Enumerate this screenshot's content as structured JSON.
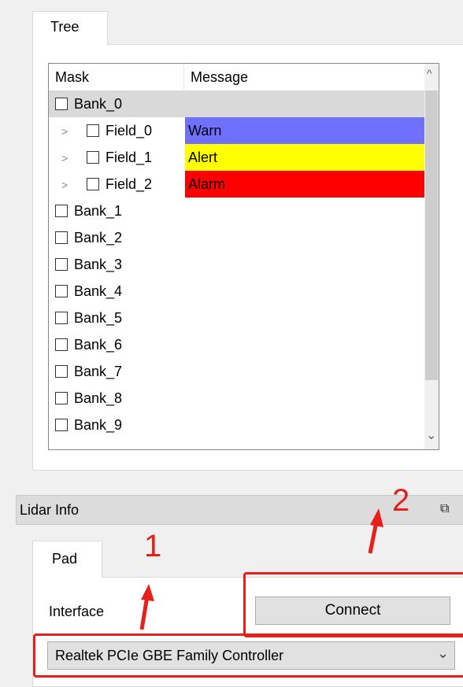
{
  "tree_tab": {
    "label": "Tree"
  },
  "table": {
    "headers": [
      "Mask",
      "Message"
    ],
    "rows": [
      {
        "label": "Bank_0",
        "level": 0,
        "selected": true,
        "message": "",
        "color": ""
      },
      {
        "label": "Field_0",
        "level": 1,
        "message": "Warn",
        "color": "#7070ff"
      },
      {
        "label": "Field_1",
        "level": 1,
        "message": "Alert",
        "color": "#ffff00"
      },
      {
        "label": "Field_2",
        "level": 1,
        "message": "Alarm",
        "color": "#ff0000"
      },
      {
        "label": "Bank_1",
        "level": 0,
        "message": "",
        "color": ""
      },
      {
        "label": "Bank_2",
        "level": 0,
        "message": "",
        "color": ""
      },
      {
        "label": "Bank_3",
        "level": 0,
        "message": "",
        "color": ""
      },
      {
        "label": "Bank_4",
        "level": 0,
        "message": "",
        "color": ""
      },
      {
        "label": "Bank_5",
        "level": 0,
        "message": "",
        "color": ""
      },
      {
        "label": "Bank_6",
        "level": 0,
        "message": "",
        "color": ""
      },
      {
        "label": "Bank_7",
        "level": 0,
        "message": "",
        "color": ""
      },
      {
        "label": "Bank_8",
        "level": 0,
        "message": "",
        "color": ""
      },
      {
        "label": "Bank_9",
        "level": 0,
        "message": "",
        "color": ""
      }
    ]
  },
  "lidar": {
    "title": "Lidar Info"
  },
  "pad_tab": {
    "label": "Pad"
  },
  "interface": {
    "label": "Interface",
    "connect_label": "Connect",
    "selected": "Realtek PCIe GBE Family Controller"
  },
  "annotations": {
    "one": "1",
    "two": "2",
    "color": "#e8201c"
  }
}
